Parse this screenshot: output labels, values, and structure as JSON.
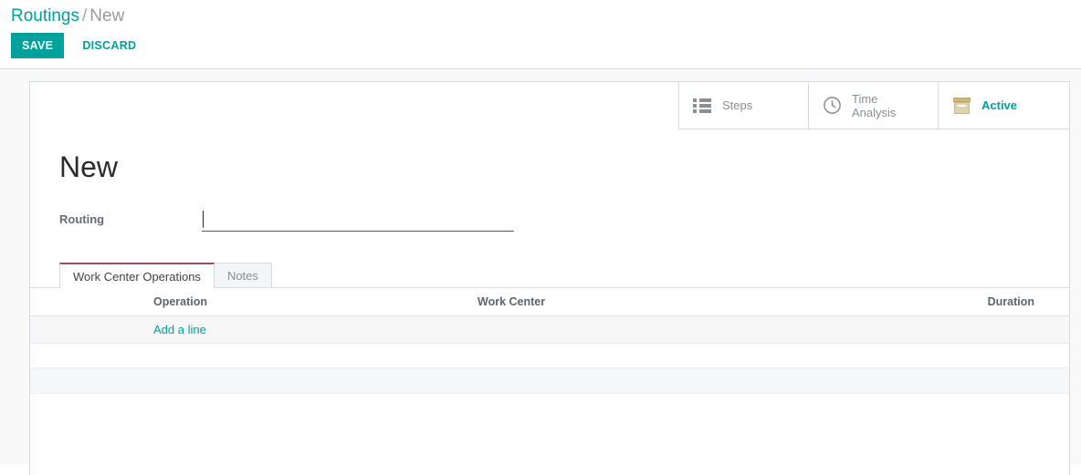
{
  "breadcrumb": {
    "root": "Routings",
    "separator": "/",
    "current": "New"
  },
  "toolbar": {
    "save_label": "SAVE",
    "discard_label": "DISCARD",
    "save_bg": "#00a09d",
    "link_color": "#00a09d"
  },
  "stat_buttons": [
    {
      "label": "Steps",
      "icon": "list-ul-icon"
    },
    {
      "label": "Time\nAnalysis",
      "icon": "clock-icon"
    },
    {
      "label": "Active",
      "icon": "archive-icon",
      "color": "#00a09d"
    }
  ],
  "record": {
    "title": "New"
  },
  "fields": {
    "routing": {
      "label": "Routing",
      "value": "",
      "placeholder": ""
    }
  },
  "notebook": {
    "tabs": [
      {
        "label": "Work Center Operations",
        "active": true
      },
      {
        "label": "Notes",
        "active": false
      }
    ]
  },
  "operations_table": {
    "columns": [
      "Operation",
      "Work Center",
      "Duration"
    ],
    "rows": [],
    "add_line_label": "Add a line"
  }
}
